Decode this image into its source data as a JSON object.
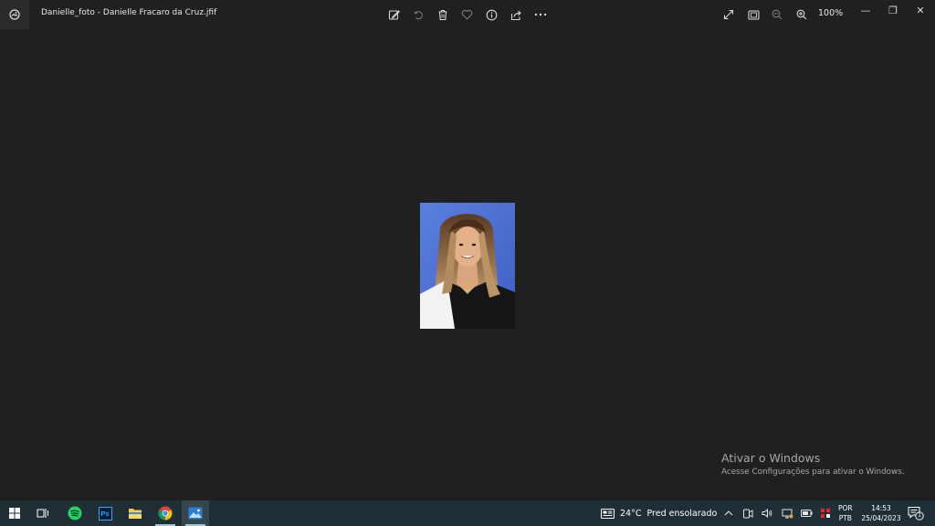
{
  "window": {
    "title": "Danielle_foto - Danielle Fracaro da Cruz.jfif",
    "app_icon": "photos-app-icon"
  },
  "toolbar": {
    "buttons": [
      {
        "name": "edit-image-icon",
        "enabled": true
      },
      {
        "name": "rotate-icon",
        "enabled": false
      },
      {
        "name": "delete-icon",
        "enabled": true
      },
      {
        "name": "favorite-heart-icon",
        "enabled": false
      },
      {
        "name": "info-icon",
        "enabled": true
      },
      {
        "name": "share-icon",
        "enabled": true
      },
      {
        "name": "more-options-icon",
        "enabled": true
      }
    ],
    "right_buttons": [
      {
        "name": "fullscreen-icon",
        "enabled": true
      },
      {
        "name": "fit-to-window-icon",
        "enabled": true
      },
      {
        "name": "zoom-out-icon",
        "enabled": false
      },
      {
        "name": "zoom-in-icon",
        "enabled": true
      }
    ],
    "zoom_level": "100%"
  },
  "window_controls": {
    "minimize": "—",
    "restore": "❐",
    "close": "✕"
  },
  "watermark": {
    "title": "Ativar o Windows",
    "subtitle": "Acesse Configurações para ativar o Windows."
  },
  "taskbar": {
    "apps": [
      {
        "name": "start-button",
        "active": false
      },
      {
        "name": "task-view-button",
        "active": false
      },
      {
        "name": "spotify-app",
        "active": false
      },
      {
        "name": "photoshop-app",
        "label": "Ps",
        "active": false
      },
      {
        "name": "file-explorer-app",
        "active": false
      },
      {
        "name": "chrome-app",
        "active": true
      },
      {
        "name": "photos-app",
        "active": true
      }
    ],
    "weather": {
      "temperature": "24°C",
      "condition": "Pred ensolarado"
    },
    "language": {
      "line1": "POR",
      "line2": "PTB"
    },
    "clock": {
      "time": "14:53",
      "date": "25/04/2023"
    },
    "notifications": {
      "count": "1"
    }
  },
  "colors": {
    "background": "#202020",
    "taskbar": "#1f2f35",
    "photo_background": "#4f6fd0"
  }
}
